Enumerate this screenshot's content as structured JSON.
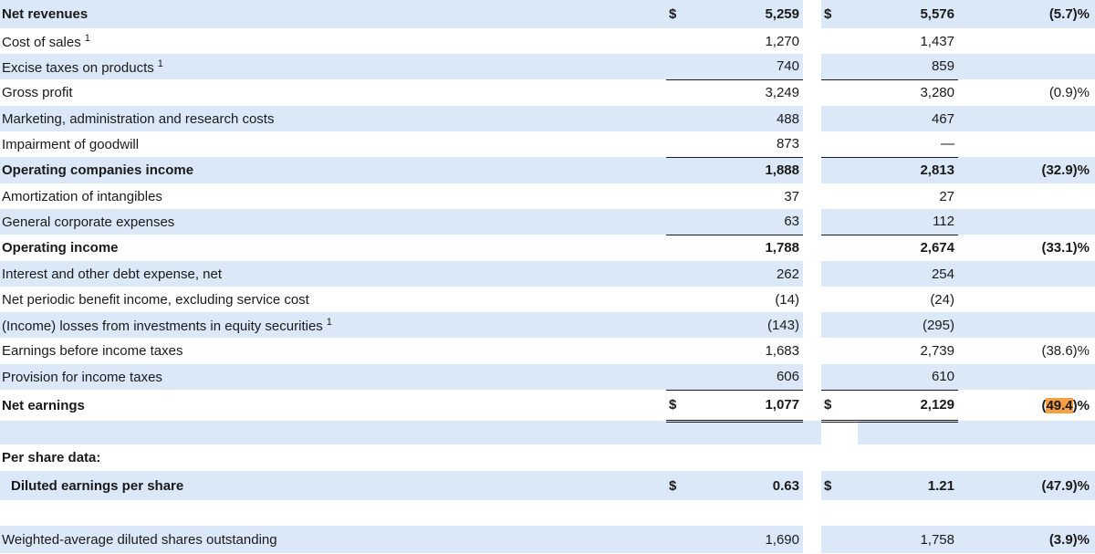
{
  "rows": [
    {
      "label": "Net revenues",
      "sup": "",
      "cur1": "$",
      "v1": "5,259",
      "cur2": "$",
      "v2": "5,576",
      "pct": "(5.7)%"
    },
    {
      "label": "Cost of sales",
      "sup": "1",
      "cur1": "",
      "v1": "1,270",
      "cur2": "",
      "v2": "1,437",
      "pct": ""
    },
    {
      "label": "Excise taxes on products",
      "sup": "1",
      "cur1": "",
      "v1": "740",
      "cur2": "",
      "v2": "859",
      "pct": ""
    },
    {
      "label": "Gross profit",
      "sup": "",
      "cur1": "",
      "v1": "3,249",
      "cur2": "",
      "v2": "3,280",
      "pct": "(0.9)%"
    },
    {
      "label": "Marketing, administration and research costs",
      "sup": "",
      "cur1": "",
      "v1": "488",
      "cur2": "",
      "v2": "467",
      "pct": ""
    },
    {
      "label": "Impairment of goodwill",
      "sup": "",
      "cur1": "",
      "v1": "873",
      "cur2": "",
      "v2": "—",
      "pct": ""
    },
    {
      "label": "Operating companies income",
      "sup": "",
      "cur1": "",
      "v1": "1,888",
      "cur2": "",
      "v2": "2,813",
      "pct": "(32.9)%"
    },
    {
      "label": "Amortization of intangibles",
      "sup": "",
      "cur1": "",
      "v1": "37",
      "cur2": "",
      "v2": "27",
      "pct": ""
    },
    {
      "label": "General corporate expenses",
      "sup": "",
      "cur1": "",
      "v1": "63",
      "cur2": "",
      "v2": "112",
      "pct": ""
    },
    {
      "label": "Operating income",
      "sup": "",
      "cur1": "",
      "v1": "1,788",
      "cur2": "",
      "v2": "2,674",
      "pct": "(33.1)%"
    },
    {
      "label": "Interest and other debt expense, net",
      "sup": "",
      "cur1": "",
      "v1": "262",
      "cur2": "",
      "v2": "254",
      "pct": ""
    },
    {
      "label": "Net periodic benefit income, excluding service cost",
      "sup": "",
      "cur1": "",
      "v1": "(14)",
      "cur2": "",
      "v2": "(24)",
      "pct": ""
    },
    {
      "label": "(Income) losses from investments in equity securities",
      "sup": "1",
      "cur1": "",
      "v1": "(143)",
      "cur2": "",
      "v2": "(295)",
      "pct": ""
    },
    {
      "label": "Earnings before income taxes",
      "sup": "",
      "cur1": "",
      "v1": "1,683",
      "cur2": "",
      "v2": "2,739",
      "pct": "(38.6)%"
    },
    {
      "label": "Provision for income taxes",
      "sup": "",
      "cur1": "",
      "v1": "606",
      "cur2": "",
      "v2": "610",
      "pct": ""
    },
    {
      "label": "Net earnings",
      "sup": "",
      "cur1": "$",
      "v1": "1,077",
      "cur2": "$",
      "v2": "2,129",
      "pct_open": "(",
      "pct_highlight": "49.4",
      "pct_close": ")%"
    }
  ],
  "per_share": {
    "heading": "Per share data:",
    "diluted": {
      "label": "Diluted earnings per share",
      "cur1": "$",
      "v1": "0.63",
      "cur2": "$",
      "v2": "1.21",
      "pct": "(47.9)%"
    }
  },
  "shares": {
    "label": "Weighted-average diluted shares outstanding",
    "v1": "1,690",
    "v2": "1,758",
    "pct": "(3.9)%"
  }
}
